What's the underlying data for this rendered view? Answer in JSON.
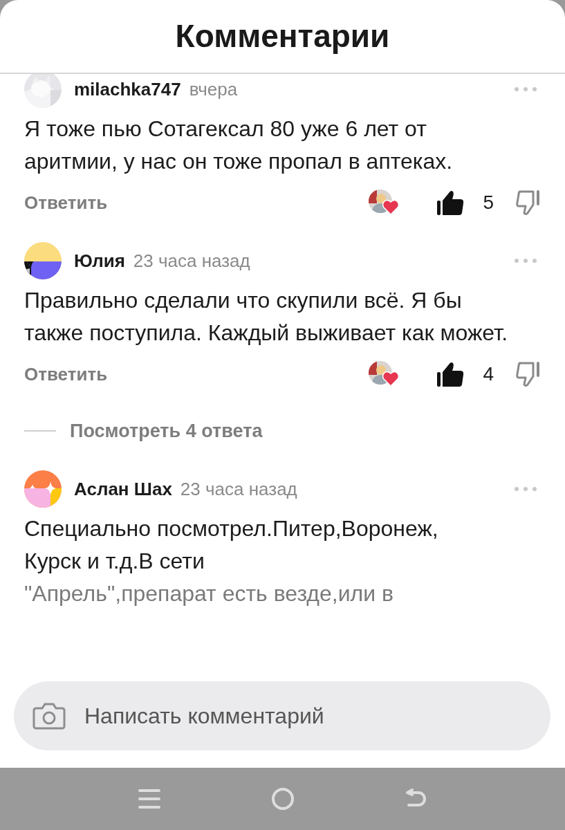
{
  "title": "Комментарии",
  "comments": [
    {
      "author": "milachka747",
      "time": "вчера",
      "lines": [
        "Я тоже пью Сотагексал 80 уже 6 лет от аритмии, у нас он тоже пропал в аптеках."
      ],
      "reply": "Ответить",
      "likes": "5"
    },
    {
      "avatar": {
        "kind": "yellow"
      },
      "author": "Юлия",
      "time": "23 часа назад",
      "lines": [
        "Правильно сделали что скупили всё. Я бы также поступила. Каждый выживает как может."
      ],
      "reply": "Ответить",
      "likes": "4",
      "more_replies": "Посмотреть 4 ответа"
    },
    {
      "avatar": {
        "kind": "orange"
      },
      "author": "Аслан Шах",
      "time": "23 часа назад",
      "lines": [
        "Специально посмотрел.Питер,Воронеж,",
        "Курск и т.д.В сети",
        "\"Апрель\",препарат есть везде,или в"
      ]
    }
  ],
  "composer": {
    "placeholder": "Написать комментарий"
  }
}
